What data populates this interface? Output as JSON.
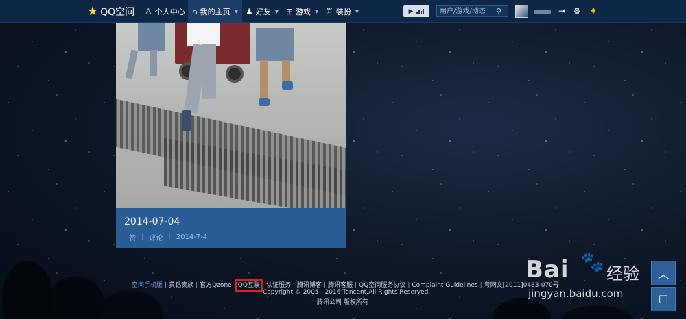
{
  "topbar": {
    "logo_label": "QQ空间",
    "nav": [
      {
        "label": "个人中心",
        "icon": "person-icon"
      },
      {
        "label": "我的主页",
        "icon": "home-icon",
        "active": true,
        "has_caret": true
      },
      {
        "label": "好友",
        "icon": "friends-icon",
        "has_caret": true
      },
      {
        "label": "游戏",
        "icon": "grid-icon",
        "has_caret": true
      },
      {
        "label": "装扮",
        "icon": "shirt-icon",
        "has_caret": true
      }
    ],
    "search": {
      "placeholder": "用户/游戏/动态"
    }
  },
  "card": {
    "title": "2014-07-04",
    "actions": {
      "like": "赞",
      "comment": "评论",
      "date": "2014-7-4"
    }
  },
  "footer": {
    "links": [
      "空间手机版",
      "黄钻贵族",
      "官方Qzone",
      "QQ互联",
      "认证服务",
      "腾讯博客",
      "腾讯客服",
      "QQ空间服务协议",
      "Complaint Guidelines",
      "粤网文[2011]0483-070号"
    ],
    "highlighted_link": "QQ互联",
    "copyright": "Copyright © 2005 - 2016 Tencent.All Rights Reserved.",
    "company": "腾讯公司 版权所有"
  },
  "watermark": {
    "brand": "Bai",
    "brand_cn": "经验",
    "url": "jingyan.baidu.com"
  },
  "colors": {
    "topbar": "#0e2746",
    "card": "#2a5d96",
    "highlight_box": "#e02020",
    "accent_link": "#69a0e6"
  }
}
